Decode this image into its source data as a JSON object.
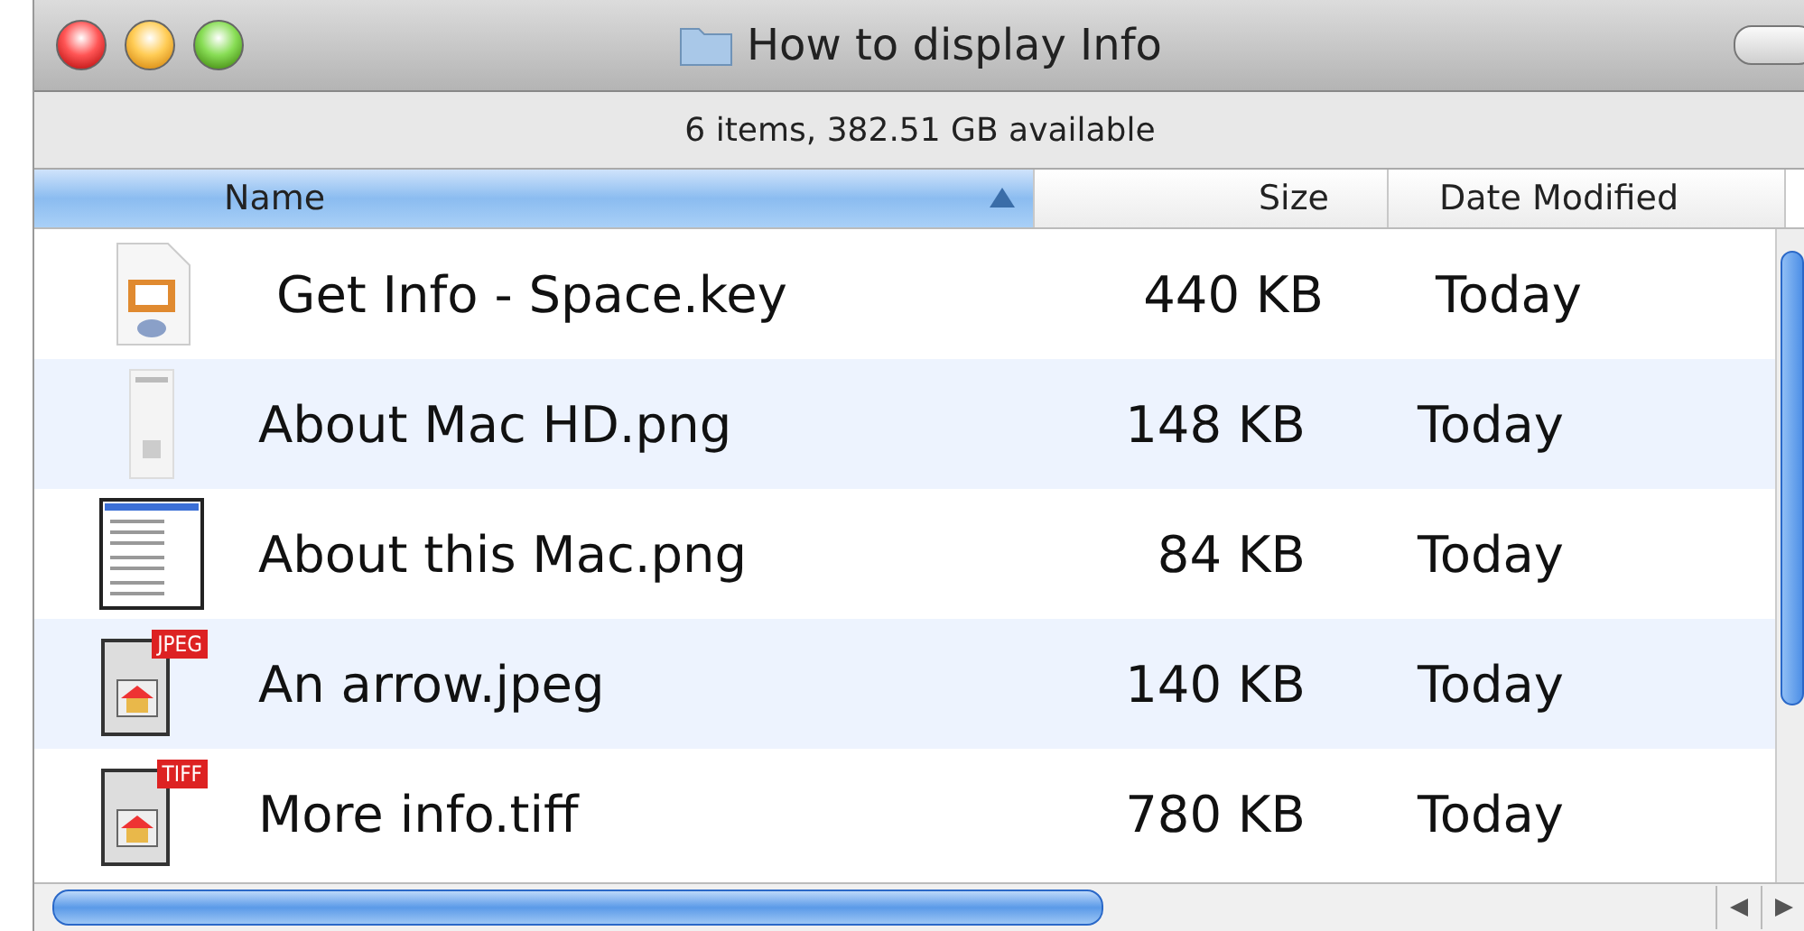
{
  "window": {
    "title": "How to display Info",
    "status": "6 items, 382.51 GB available"
  },
  "columns": [
    {
      "label": "Name",
      "selected": true
    },
    {
      "label": "Size",
      "selected": false
    },
    {
      "label": "Date Modified",
      "selected": false
    }
  ],
  "rows": [
    {
      "kind": "keynote",
      "name": "Get Info - Space.key",
      "size": "440 KB",
      "date": "Today"
    },
    {
      "kind": "thumbnail",
      "name": "About Mac HD.png",
      "size": "148 KB",
      "date": "Today"
    },
    {
      "kind": "screenshot",
      "name": "About this Mac.png",
      "size": "84 KB",
      "date": "Today"
    },
    {
      "kind": "badge",
      "badge": "JPEG",
      "name": "An arrow.jpeg",
      "size": "140 KB",
      "date": "Today"
    },
    {
      "kind": "badge",
      "badge": "TIFF",
      "name": "More info.tiff",
      "size": "780 KB",
      "date": "Today"
    }
  ]
}
